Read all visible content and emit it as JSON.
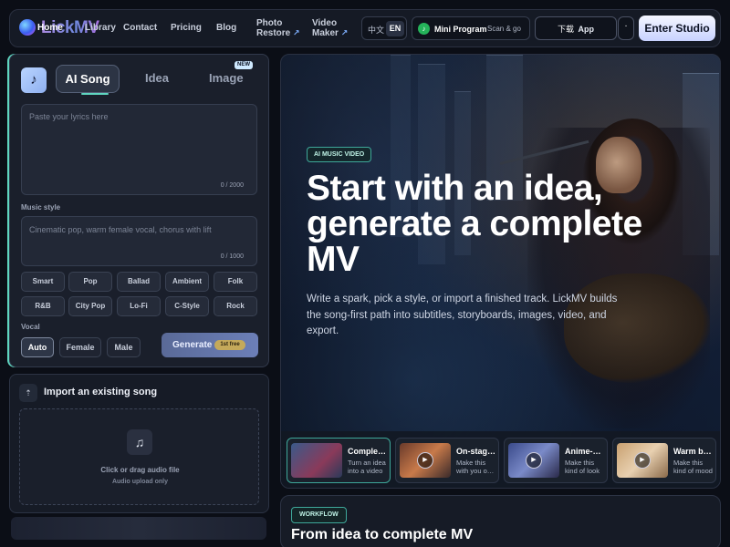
{
  "nav": {
    "logo_text": "LickMV",
    "home": "Home",
    "library": "Library",
    "contact": "Contact",
    "pricing": "Pricing",
    "blog": "Blog",
    "photo_restore_1": "Photo",
    "photo_restore_2": "Restore",
    "video_maker_1": "Video",
    "video_maker_2": "Maker",
    "ext_arrow": "↗",
    "lang_zh": "中文",
    "lang_en": "EN",
    "mini_program": "Mini Program",
    "mini_program_sub": "Scan & go",
    "download_cn": "下载",
    "download_app": "App",
    "more": "·",
    "enter_studio": "Enter Studio"
  },
  "panel": {
    "note_icon": "♪",
    "tabs": {
      "ai_song": "AI Song",
      "idea": "Idea",
      "image": "Image",
      "new_badge": "NEW"
    },
    "lyrics_placeholder": "Paste your lyrics here",
    "lyrics_count": "0 / 2000",
    "music_style_label": "Music style",
    "style_placeholder": "Cinematic pop, warm female vocal, chorus with lift",
    "style_count": "0 / 1000",
    "chips": [
      "Smart",
      "Pop",
      "Ballad",
      "Ambient",
      "Folk",
      "R&B",
      "City Pop",
      "Lo-Fi",
      "C-Style",
      "Rock"
    ],
    "vocal_label": "Vocal",
    "vocal_options": [
      "Auto",
      "Female",
      "Male"
    ],
    "generate": "Generate",
    "first_free": "1st free"
  },
  "import": {
    "title": "Import an existing song",
    "drop_text": "Click or drag audio file",
    "drop_sub": "Audio upload only"
  },
  "hero": {
    "badge": "AI MUSIC VIDEO",
    "title": "Start with an idea, generate a complete MV",
    "desc": "Write a spark, pick a style, or import a finished track. LickMV builds the song-first path into subtitles, storyboards, images, video, and export.",
    "thumbs": [
      {
        "title": "Comple…",
        "sub": "Turn an idea into a video"
      },
      {
        "title": "On-stag…",
        "sub": "Make this with you o…"
      },
      {
        "title": "Anime-…",
        "sub": "Make this kind of look"
      },
      {
        "title": "Warm b…",
        "sub": "Make this kind of mood"
      }
    ]
  },
  "workflow": {
    "badge": "WORKFLOW",
    "title": "From idea to complete MV"
  }
}
